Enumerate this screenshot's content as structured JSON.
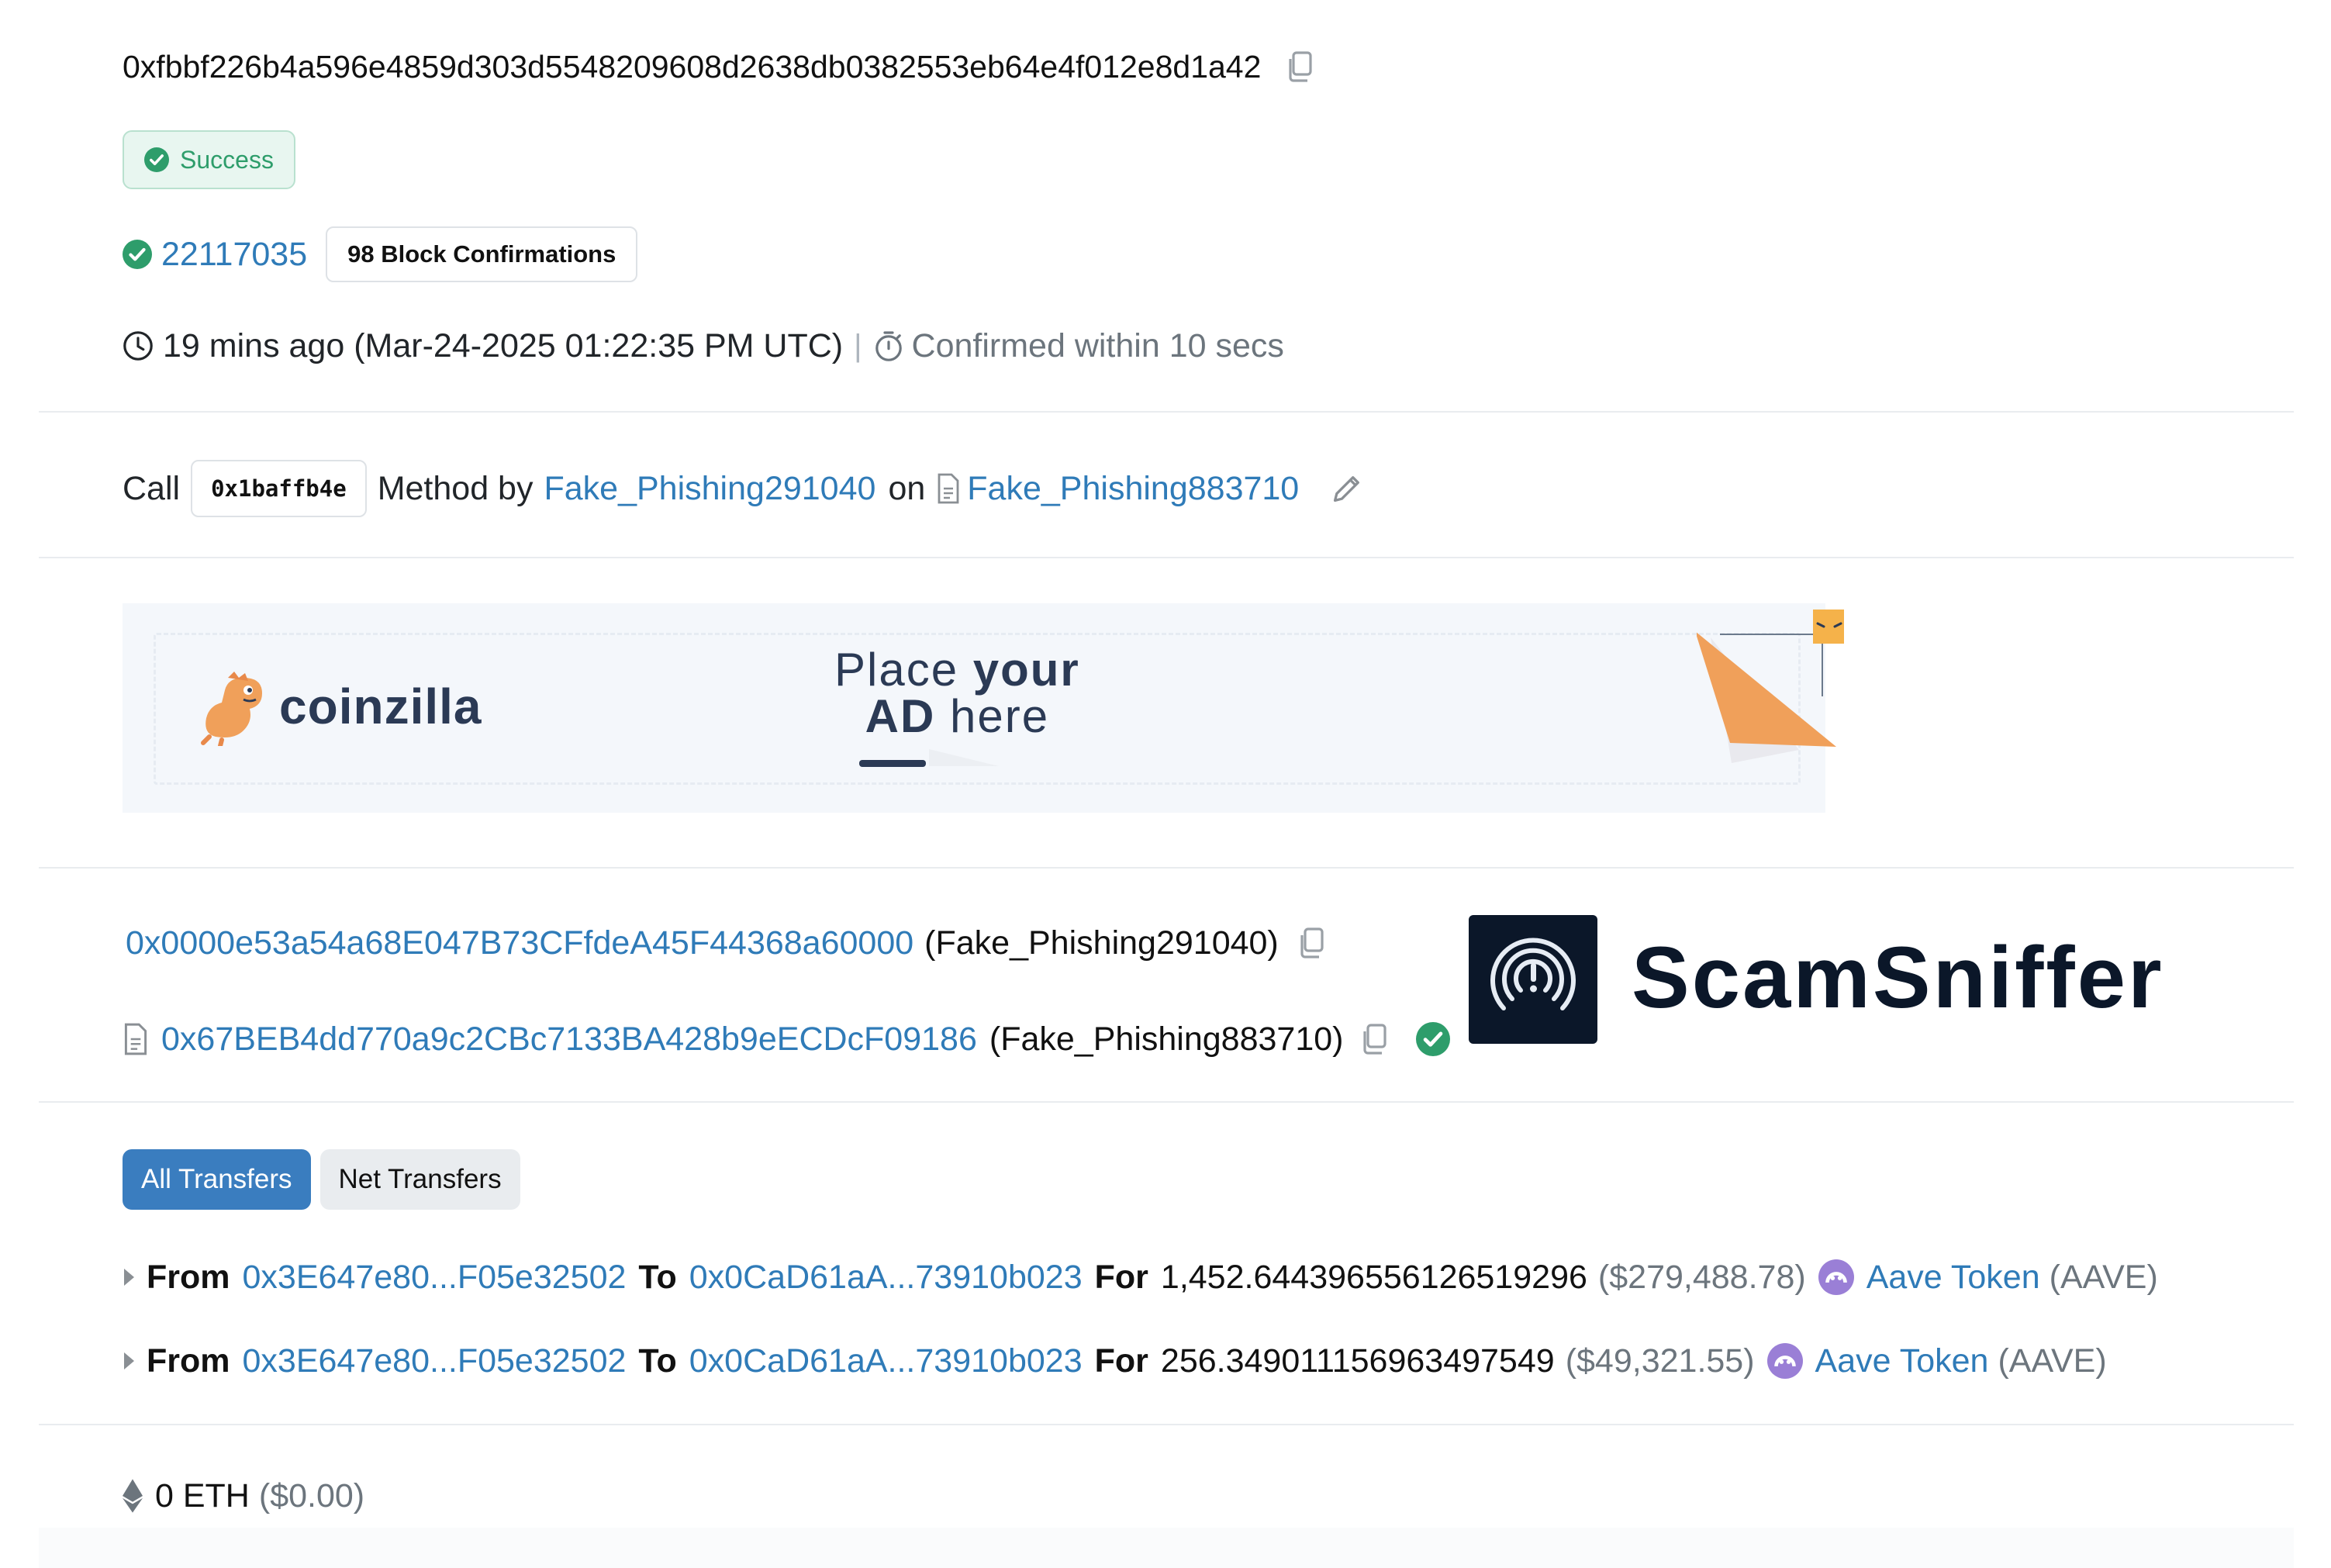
{
  "tx": {
    "hash": "0xfbbf226b4a596e4859d303d5548209608d2638db0382553eb64e4f012e8d1a42",
    "status": "Success",
    "block_number": "22117035",
    "block_confirmations": "98 Block Confirmations",
    "timestamp_relative": "19 mins ago (Mar-24-2025 01:22:35 PM UTC)",
    "separator": "|",
    "confirmed_text": "Confirmed within 10 secs"
  },
  "action": {
    "call_label": "Call",
    "method_id": "0x1baffb4e",
    "method_by_label": "Method by",
    "caller_name": "Fake_Phishing291040",
    "on_label": "on",
    "contract_name": "Fake_Phishing883710"
  },
  "ad": {
    "brand": "coinzilla",
    "line1_a": "Place ",
    "line1_b": "your",
    "line2_a": "AD",
    "line2_b": " here"
  },
  "addresses": {
    "from_address": "0x0000e53a54a68E047B73CFfdeA45F44368a60000",
    "from_label": "(Fake_Phishing291040)",
    "to_address": "0x67BEB4dd770a9c2CBc7133BA428b9eECDcF09186",
    "to_label": "(Fake_Phishing883710)"
  },
  "scamsniffer": {
    "brand": "ScamSniffer"
  },
  "transfers": {
    "tabs": [
      {
        "label": "All Transfers",
        "active": true
      },
      {
        "label": "Net Transfers",
        "active": false
      }
    ],
    "from_label": "From",
    "to_label": "To",
    "for_label": "For",
    "rows": [
      {
        "from": "0x3E647e80...F05e32502",
        "to": "0x0CaD61aA...73910b023",
        "amount": "1,452.644396556126519296",
        "usd": "($279,488.78)",
        "token_name": "Aave Token",
        "token_symbol": "(AAVE)"
      },
      {
        "from": "0x3E647e80...F05e32502",
        "to": "0x0CaD61aA...73910b023",
        "amount": "256.349011156963497549",
        "usd": "($49,321.55)",
        "token_name": "Aave Token",
        "token_symbol": "(AAVE)"
      }
    ]
  },
  "value": {
    "eth": "0 ETH",
    "usd": "($0.00)"
  },
  "colors": {
    "link": "#2f7bb8",
    "success": "#2e9d6b",
    "success_bg": "#e8f6f0",
    "tab_active": "#3a7dbf",
    "aave": "#9a7fd6",
    "ad_orange": "#f0a05a",
    "ad_navy": "#2b3a55"
  }
}
